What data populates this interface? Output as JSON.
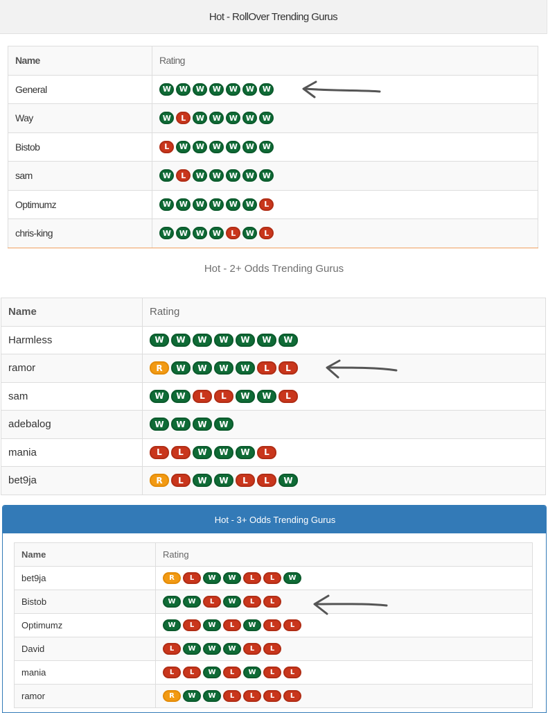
{
  "columns": {
    "name": "Name",
    "rating": "Rating"
  },
  "colors": {
    "win": "#0f6b36",
    "loss": "#c9361c",
    "refund": "#f29a13",
    "panel_blue": "#337ab7"
  },
  "panels": [
    {
      "title": "Hot - RollOver Trending Gurus",
      "rows": [
        {
          "name": "General",
          "ratings": [
            "W",
            "W",
            "W",
            "W",
            "W",
            "W",
            "W"
          ]
        },
        {
          "name": "Way",
          "ratings": [
            "W",
            "L",
            "W",
            "W",
            "W",
            "W",
            "W"
          ]
        },
        {
          "name": "Bistob",
          "ratings": [
            "L",
            "W",
            "W",
            "W",
            "W",
            "W",
            "W"
          ]
        },
        {
          "name": "sam",
          "ratings": [
            "W",
            "L",
            "W",
            "W",
            "W",
            "W",
            "W"
          ]
        },
        {
          "name": "Optimumz",
          "ratings": [
            "W",
            "W",
            "W",
            "W",
            "W",
            "W",
            "L"
          ]
        },
        {
          "name": "chris-king",
          "ratings": [
            "W",
            "W",
            "W",
            "W",
            "L",
            "W",
            "L"
          ]
        }
      ]
    },
    {
      "title": "Hot - 2+ Odds Trending Gurus",
      "rows": [
        {
          "name": "Harmless",
          "ratings": [
            "W",
            "W",
            "W",
            "W",
            "W",
            "W",
            "W"
          ]
        },
        {
          "name": "ramor",
          "ratings": [
            "R",
            "W",
            "W",
            "W",
            "W",
            "L",
            "L"
          ]
        },
        {
          "name": "sam",
          "ratings": [
            "W",
            "W",
            "L",
            "L",
            "W",
            "W",
            "L"
          ]
        },
        {
          "name": "adebalog",
          "ratings": [
            "W",
            "W",
            "W",
            "W"
          ]
        },
        {
          "name": "mania",
          "ratings": [
            "L",
            "L",
            "W",
            "W",
            "W",
            "L"
          ]
        },
        {
          "name": "bet9ja",
          "ratings": [
            "R",
            "L",
            "W",
            "W",
            "L",
            "L",
            "W"
          ]
        }
      ]
    },
    {
      "title": "Hot - 3+ Odds Trending Gurus",
      "rows": [
        {
          "name": "bet9ja",
          "ratings": [
            "R",
            "L",
            "W",
            "W",
            "L",
            "L",
            "W"
          ]
        },
        {
          "name": "Bistob",
          "ratings": [
            "W",
            "W",
            "L",
            "W",
            "L",
            "L"
          ]
        },
        {
          "name": "Optimumz",
          "ratings": [
            "W",
            "L",
            "W",
            "L",
            "W",
            "L",
            "L"
          ]
        },
        {
          "name": "David",
          "ratings": [
            "L",
            "W",
            "W",
            "W",
            "L",
            "L"
          ]
        },
        {
          "name": "mania",
          "ratings": [
            "L",
            "L",
            "W",
            "L",
            "W",
            "L",
            "L"
          ]
        },
        {
          "name": "ramor",
          "ratings": [
            "R",
            "W",
            "W",
            "L",
            "L",
            "L",
            "L"
          ]
        }
      ]
    }
  ]
}
